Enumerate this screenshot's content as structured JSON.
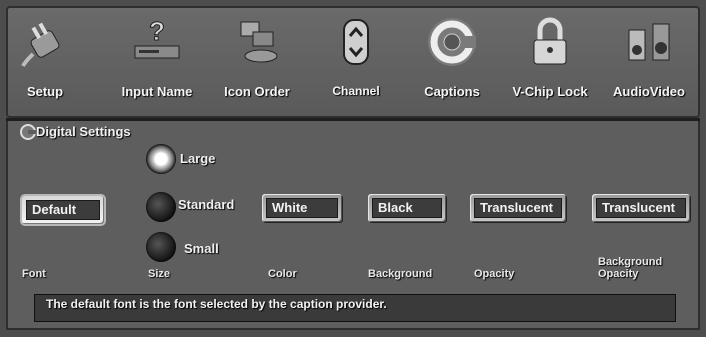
{
  "tabs": [
    {
      "label": "Setup",
      "icon": "plug-icon"
    },
    {
      "label": "Input Name",
      "icon": "question-device-icon"
    },
    {
      "label": "Icon Order",
      "icon": "icons-stack-icon"
    },
    {
      "label": "Channel",
      "icon": "up-down-icon"
    },
    {
      "label": "Captions",
      "icon": "captions-disc-icon"
    },
    {
      "label": "V-Chip Lock",
      "icon": "padlock-icon"
    },
    {
      "label": "AudioVideo",
      "icon": "speakers-icon"
    }
  ],
  "section": {
    "title": "Digital Settings",
    "icon": "captions-small-icon"
  },
  "font": {
    "value": "Default",
    "label": "Font"
  },
  "size": {
    "options": [
      "Large",
      "Standard",
      "Small"
    ],
    "selected": "Large",
    "label": "Size"
  },
  "color": {
    "value": "White",
    "label": "Color"
  },
  "background": {
    "value": "Black",
    "label": "Background"
  },
  "opacity": {
    "value": "Translucent",
    "label": "Opacity"
  },
  "background_opacity": {
    "value": "Translucent",
    "label_line1": "Background",
    "label_line2": "Opacity"
  },
  "status": {
    "text": "The default font is the font selected by the caption provider."
  }
}
